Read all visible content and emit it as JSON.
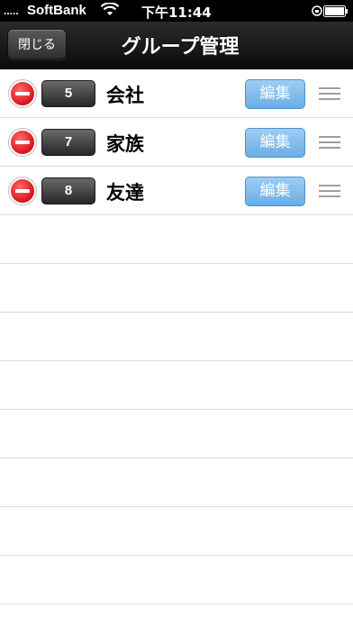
{
  "status_bar": {
    "signal": ".....",
    "carrier": "SoftBank",
    "time": "下午11:44",
    "wifi_icon": "wifi-icon",
    "lock_icon": "rotation-lock-icon",
    "battery_icon": "battery-icon"
  },
  "nav": {
    "close_label": "閉じる",
    "title": "グループ管理"
  },
  "groups": [
    {
      "count": "5",
      "name": "会社",
      "edit_label": "編集"
    },
    {
      "count": "7",
      "name": "家族",
      "edit_label": "編集"
    },
    {
      "count": "8",
      "name": "友達",
      "edit_label": "編集"
    }
  ],
  "colors": {
    "delete_red": "#d8121c",
    "edit_blue": "#6aaee5",
    "nav_black": "#111111"
  }
}
